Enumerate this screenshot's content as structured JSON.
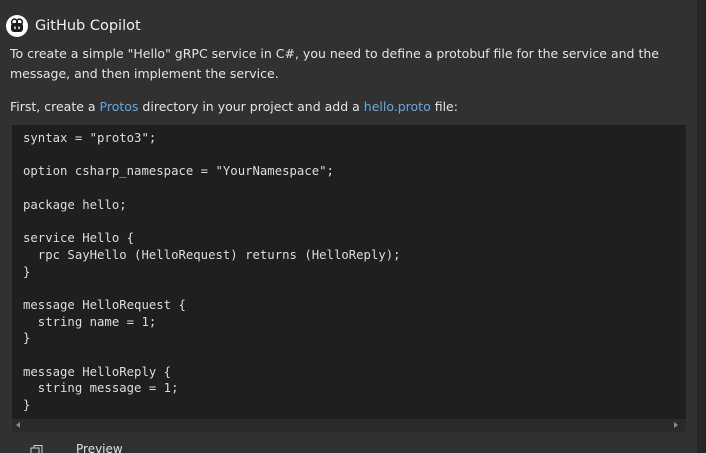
{
  "header": {
    "title": "GitHub Copilot",
    "avatar_icon": "copilot-icon"
  },
  "message": {
    "para1": "To create a simple \"Hello\" gRPC service in C#, you need to define a protobuf file for the service and the message, and then implement the service.",
    "para2_prefix": "First, create a ",
    "para2_link1": "Protos",
    "para2_middle": " directory in your project and add a ",
    "para2_link2": "hello.proto",
    "para2_suffix": " file:"
  },
  "code": {
    "lines": [
      "syntax = \"proto3\";",
      "",
      "option csharp_namespace = \"YourNamespace\";",
      "",
      "package hello;",
      "",
      "service Hello {",
      "  rpc SayHello (HelloRequest) returns (HelloReply);",
      "}",
      "",
      "message HelloRequest {",
      "  string name = 1;",
      "}",
      "",
      "message HelloReply {",
      "  string message = 1;",
      "}"
    ]
  },
  "footer": {
    "copy_icon": "copy-icon",
    "preview_label": "Preview"
  },
  "colors": {
    "panel_bg": "#313131",
    "code_bg": "#1f1f1f",
    "link": "#5ea9e8"
  }
}
